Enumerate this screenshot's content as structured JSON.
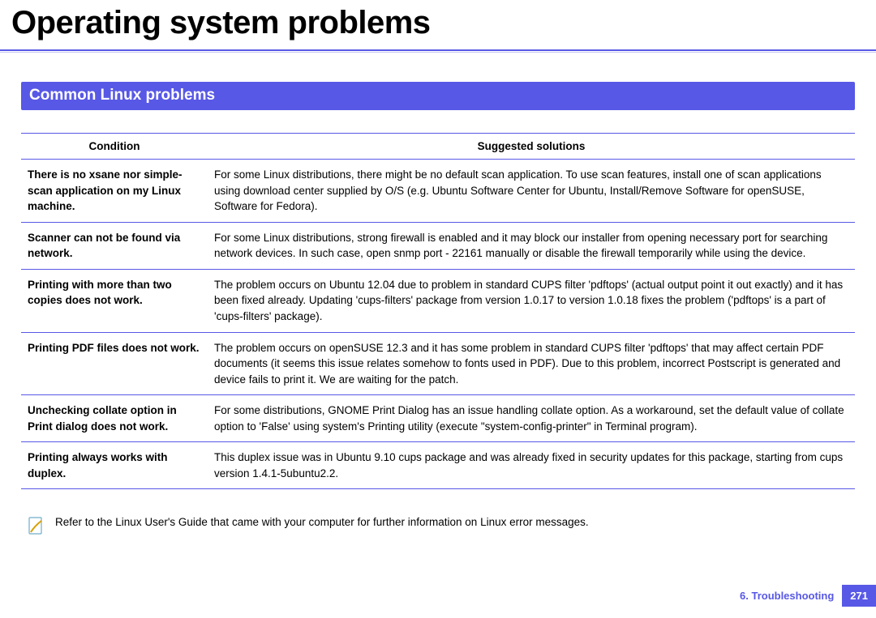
{
  "title": "Operating system problems",
  "section": "Common Linux problems",
  "columns": {
    "condition": "Condition",
    "solutions": "Suggested solutions"
  },
  "rows": [
    {
      "condition": "There is no xsane nor simple-scan application on my Linux machine.",
      "solution": "For some Linux distributions, there might be no default scan application. To use scan features, install one of scan applications using download center supplied by O/S (e.g. Ubuntu Software Center for Ubuntu, Install/Remove Software for openSUSE, Software for Fedora)."
    },
    {
      "condition": "Scanner can not be found via network.",
      "solution": "For some Linux distributions, strong firewall is enabled and it may block our installer from opening necessary port for searching network devices. In such case, open snmp port - 22161 manually or disable the firewall temporarily while using the device."
    },
    {
      "condition": "Printing with more than two copies does not work.",
      "solution": "The problem occurs on Ubuntu 12.04 due to problem in standard CUPS filter 'pdftops' (actual output point it out exactly) and it has been fixed already. Updating 'cups-filters' package from version 1.0.17 to version 1.0.18 fixes the problem ('pdftops' is a part of 'cups-filters' package)."
    },
    {
      "condition": "Printing PDF files does not work.",
      "solution": "The problem occurs on openSUSE 12.3 and it has some problem in standard CUPS filter 'pdftops' that may affect certain PDF documents (it seems this issue relates somehow to fonts used in PDF). Due to this problem, incorrect Postscript is generated and device fails to print it. We are waiting for the patch."
    },
    {
      "condition": "Unchecking collate option in Print dialog does not work.",
      "solution": "For some distributions, GNOME Print Dialog has an issue handling collate option. As a workaround, set the default value of collate option to 'False' using system's Printing utility (execute \"system-config-printer\" in Terminal program)."
    },
    {
      "condition": "Printing always works with duplex.",
      "solution": "This duplex issue was in Ubuntu 9.10 cups package and was already fixed in security updates for this package, starting from cups version 1.4.1-5ubuntu2.2."
    }
  ],
  "note": "Refer to the Linux User's Guide that came with your computer for further information on Linux error messages.",
  "footer": {
    "chapter": "6.  Troubleshooting",
    "page": "271"
  }
}
